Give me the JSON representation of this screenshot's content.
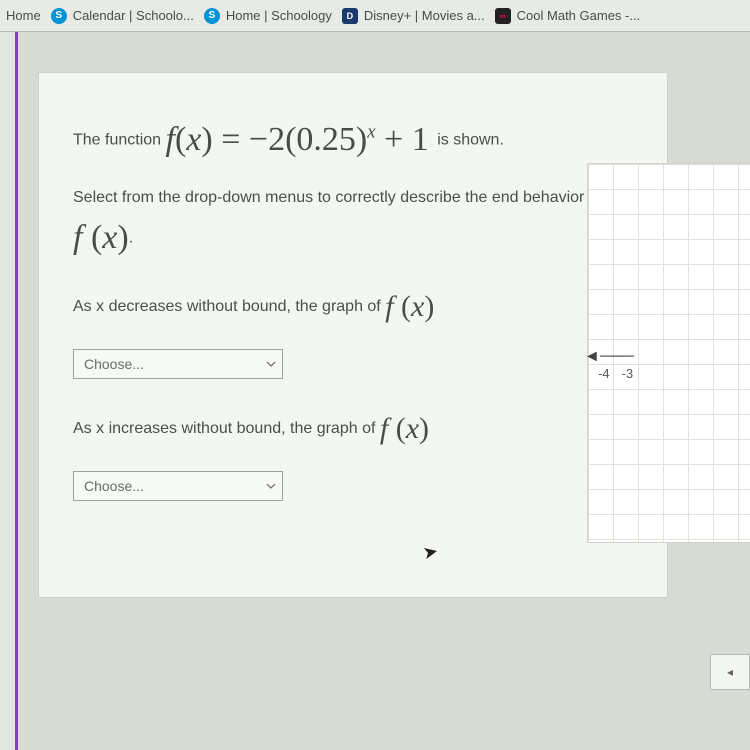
{
  "bookmarks": [
    {
      "label": "Home",
      "icon": ""
    },
    {
      "label": "Calendar | Schoolo...",
      "icon": "S",
      "iconClass": "favicon-s"
    },
    {
      "label": "Home | Schoology",
      "icon": "S",
      "iconClass": "favicon-s"
    },
    {
      "label": "Disney+ | Movies a...",
      "icon": "D",
      "iconClass": "favicon-d"
    },
    {
      "label": "Cool Math Games -...",
      "icon": "∞",
      "iconClass": "favicon-c"
    }
  ],
  "question": {
    "intro_prefix": "The function ",
    "function_expr": "f(x) = −2(0.25)ˣ + 1",
    "intro_suffix": " is shown.",
    "instruction_prefix": "Select from the drop-down menus to correctly describe the end behavior of ",
    "fx_label": "f (x)",
    "period": ".",
    "prompt1": "As x decreases without bound, the graph of ",
    "prompt2": "As x increases without bound, the graph of ",
    "dropdown_placeholder": "Choose..."
  },
  "graph": {
    "tick_labels": [
      "-4",
      "-3"
    ]
  },
  "nav": {
    "prev_glyph": "◂"
  }
}
